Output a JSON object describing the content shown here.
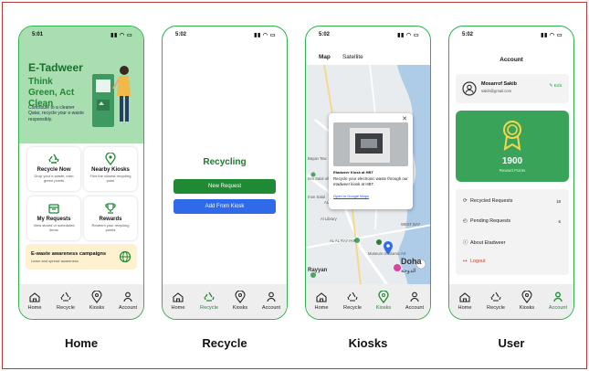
{
  "captions": {
    "home": "Home",
    "recycle": "Recycle",
    "kiosks": "Kiosks",
    "user": "User"
  },
  "status": {
    "home": "5:01",
    "recycle": "5:02",
    "kiosks": "5:02",
    "user": "5:02"
  },
  "tabs": [
    "Home",
    "Recycle",
    "Kiosks",
    "Account"
  ],
  "colors": {
    "primary": "#1e8a34",
    "hero": "#a8deb0",
    "blue": "#2f6be8",
    "reward": "#3aa35a",
    "banner": "#fdf1cf",
    "border": "#2fb14f"
  },
  "home": {
    "brand": "E-Tadweer",
    "slogan": "Think Green, Act Clean",
    "description": "Contribute to a cleaner Qatar, recycle your e-waste responsibly.",
    "cards": [
      {
        "icon": "recycle-icon",
        "title": "Recycle Now",
        "subtitle": "Drop your e-waste, earn green points"
      },
      {
        "icon": "location-icon",
        "title": "Nearby Kiosks",
        "subtitle": "Find the closest recycling point"
      },
      {
        "icon": "inbox-icon",
        "title": "My Requests",
        "subtitle": "View stored or scheduled items"
      },
      {
        "icon": "trophy-icon",
        "title": "Rewards",
        "subtitle": "Redeem your recycling points"
      }
    ],
    "banner": {
      "title": "E-waste awareness campaigns",
      "subtitle": "Learn and spread awareness"
    }
  },
  "recycle": {
    "title": "Recycling",
    "new_request": "New Request",
    "add_from_kiosk": "Add From Kiosk"
  },
  "kiosks": {
    "map_tab": "Map",
    "satellite_tab": "Satellite",
    "popup_title": "Etadweer Kiosk at HBT",
    "popup_desc": "Recycle your electronic waste through our etadweer kiosk at HBT.",
    "popup_link": "Open in Google Maps",
    "labels": [
      "Bayan Tow",
      "mm Salal ohammed",
      "rnon Salal",
      "University",
      "Tower Mall",
      "AL GHARRAFA",
      "Al Library",
      "AL AL RAYYAN",
      "WEST BAY",
      "Museum of Islamic Art",
      "Rayyan",
      "Doha",
      "الدوحة"
    ]
  },
  "user": {
    "title": "Account",
    "name": "Mosarrof Sakib",
    "email": "sakib@gmail.com",
    "edit": "Edit",
    "points": "1900",
    "points_label": "Reward Points",
    "menu": [
      {
        "icon": "recycle-icon",
        "label": "Recycled Requests",
        "count": "18"
      },
      {
        "icon": "pending-icon",
        "label": "Pending Requests",
        "count": "6"
      },
      {
        "icon": "info-icon",
        "label": "About Etadweer",
        "count": ""
      },
      {
        "icon": "logout-icon",
        "label": "Logout",
        "count": ""
      }
    ]
  }
}
